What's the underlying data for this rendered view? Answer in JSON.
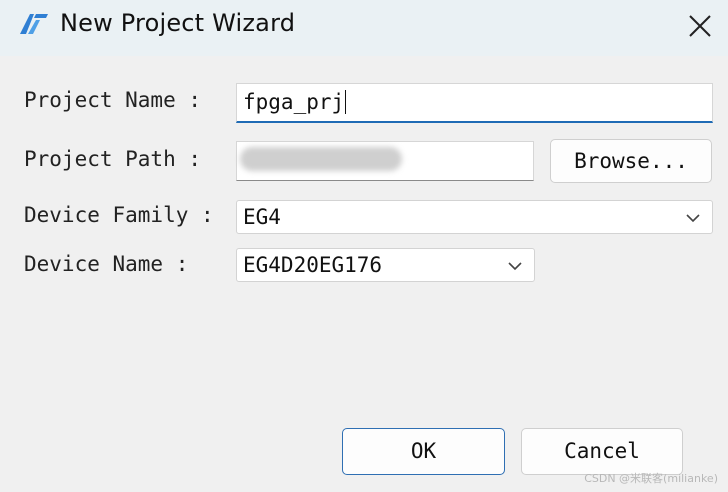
{
  "window": {
    "title": "New Project Wizard",
    "icon": "app-logo-icon",
    "close_icon": "close-icon"
  },
  "form": {
    "project_name": {
      "label": "Project Name :",
      "value": "fpga_prj"
    },
    "project_path": {
      "label": "Project Path :",
      "value": "",
      "browse_label": "Browse..."
    },
    "device_family": {
      "label": "Device Family :",
      "value": "EG4"
    },
    "device_name": {
      "label": "Device Name :",
      "value": "EG4D20EG176"
    }
  },
  "buttons": {
    "ok": "OK",
    "cancel": "Cancel"
  },
  "watermark": "CSDN @米联客(milianke)",
  "colors": {
    "accent": "#1f6bb5",
    "titlebar": "#eaf1f4",
    "background": "#f0f0f0"
  }
}
